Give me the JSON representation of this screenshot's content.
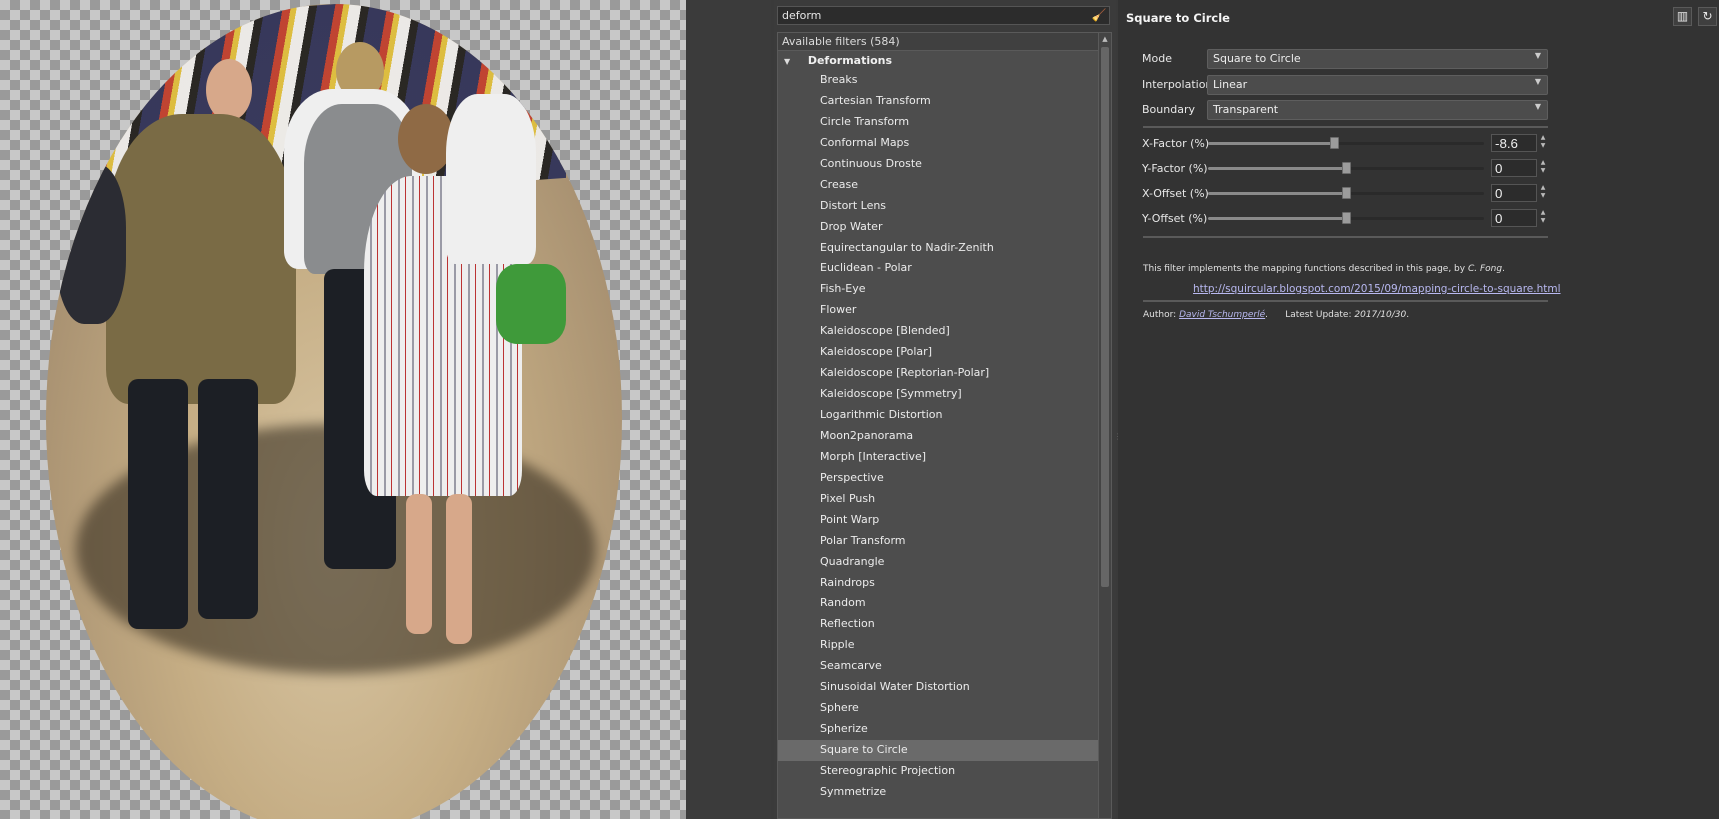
{
  "search": {
    "value": "deform",
    "clear_icon": "broom-clear-icon"
  },
  "tree": {
    "header": "Available filters (584)",
    "category": "Deformations",
    "filters": [
      "Breaks",
      "Cartesian Transform",
      "Circle Transform",
      "Conformal Maps",
      "Continuous Droste",
      "Crease",
      "Distort Lens",
      "Drop Water",
      "Equirectangular to Nadir-Zenith",
      "Euclidean - Polar",
      "Fish-Eye",
      "Flower",
      "Kaleidoscope [Blended]",
      "Kaleidoscope [Polar]",
      "Kaleidoscope [Reptorian-Polar]",
      "Kaleidoscope [Symmetry]",
      "Logarithmic Distortion",
      "Moon2panorama",
      "Morph [Interactive]",
      "Perspective",
      "Pixel Push",
      "Point Warp",
      "Polar Transform",
      "Quadrangle",
      "Raindrops",
      "Random",
      "Reflection",
      "Ripple",
      "Seamcarve",
      "Sinusoidal Water Distortion",
      "Sphere",
      "Spherize",
      "Square to Circle",
      "Stereographic Projection",
      "Symmetrize"
    ],
    "selected": "Square to Circle"
  },
  "params": {
    "title": "Square to Circle",
    "combos": [
      {
        "label": "Mode",
        "value": "Square to Circle"
      },
      {
        "label": "Interpolation",
        "value": "Linear"
      },
      {
        "label": "Boundary",
        "value": "Transparent"
      }
    ],
    "sliders": [
      {
        "label": "X-Factor (%)",
        "value": "-8.6",
        "fraction": 0.457
      },
      {
        "label": "Y-Factor (%)",
        "value": "0",
        "fraction": 0.5
      },
      {
        "label": "X-Offset (%)",
        "value": "0",
        "fraction": 0.5
      },
      {
        "label": "Y-Offset (%)",
        "value": "0",
        "fraction": 0.5
      }
    ],
    "description": "This filter implements the mapping functions described in this page, by",
    "description_author": "C. Fong",
    "link": "http://squircular.blogspot.com/2015/09/mapping-circle-to-square.html",
    "author_prefix": "Author:",
    "author": "David Tschumperlé",
    "update_prefix": "Latest Update:",
    "update_date": "2017/10/30"
  },
  "colors": {
    "panel_bg": "#333333",
    "tree_bg": "#4d4d4d",
    "selection": "#6a6a6a",
    "link": "#b8b8f0"
  }
}
